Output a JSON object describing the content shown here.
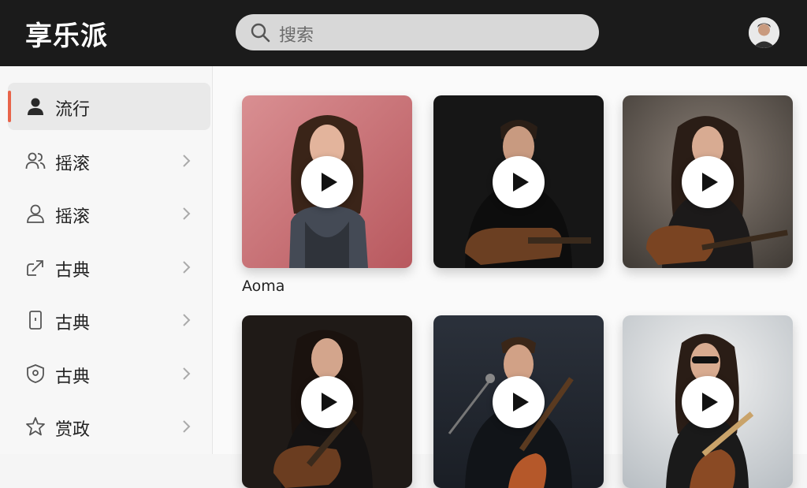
{
  "app": {
    "title": "享乐派"
  },
  "search": {
    "placeholder": "搜索"
  },
  "sidebar": {
    "items": [
      {
        "label": "流行",
        "icon": "user-icon",
        "active": true
      },
      {
        "label": "摇滚",
        "icon": "users-icon",
        "active": false
      },
      {
        "label": "摇滚",
        "icon": "user-outline-icon",
        "active": false
      },
      {
        "label": "古典",
        "icon": "share-icon",
        "active": false
      },
      {
        "label": "古典",
        "icon": "device-icon",
        "active": false
      },
      {
        "label": "古典",
        "icon": "shield-icon",
        "active": false
      },
      {
        "label": "赏政",
        "icon": "star-icon",
        "active": false
      }
    ]
  },
  "grid": {
    "cards": [
      {
        "caption": "Aoma",
        "theme": "pink-portrait"
      },
      {
        "caption": "",
        "theme": "dark-guitar-male"
      },
      {
        "caption": "",
        "theme": "grey-guitar-female"
      },
      {
        "caption": "",
        "theme": "dark-guitar-female"
      },
      {
        "caption": "",
        "theme": "dark-mic-male"
      },
      {
        "caption": "",
        "theme": "light-guitar-female"
      }
    ]
  },
  "colors": {
    "topbar": "#1b1b1b",
    "accent": "#e8644a",
    "sidebar_bg": "#f7f7f7",
    "content_bg": "#fafafa"
  }
}
